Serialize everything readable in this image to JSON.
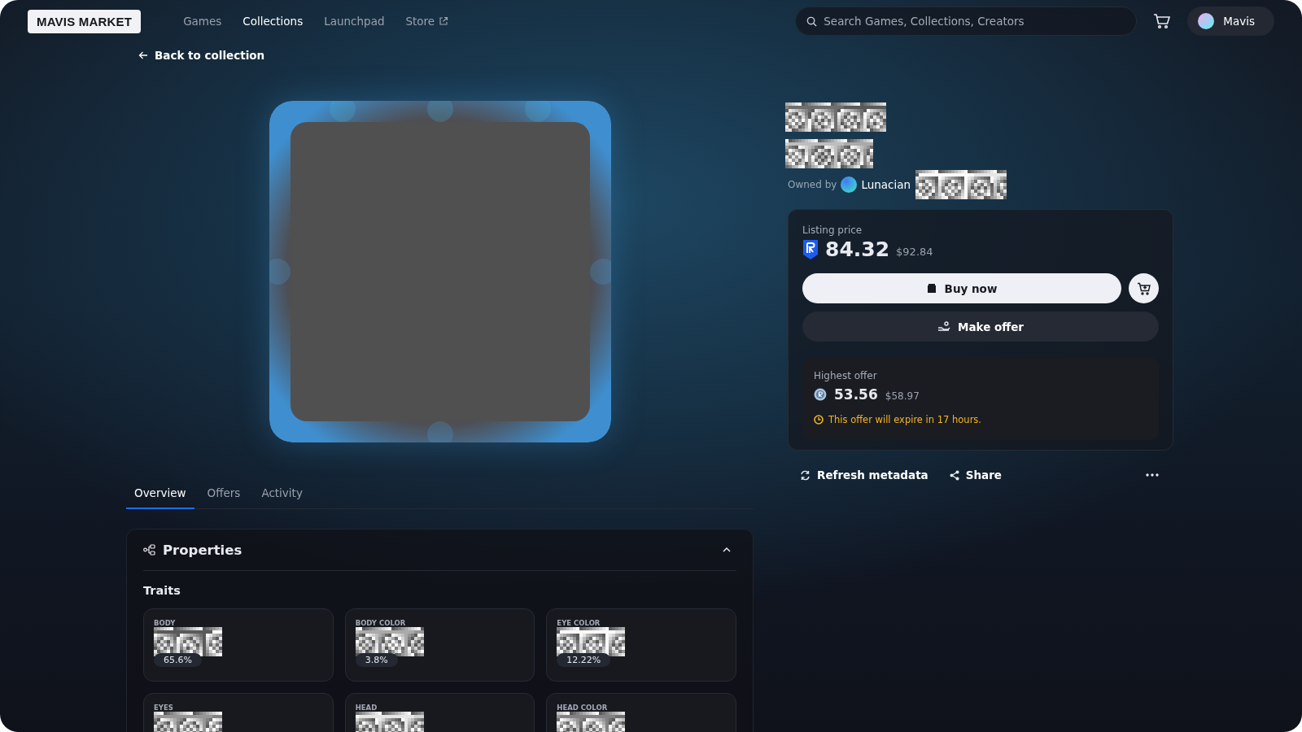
{
  "brand": "MAVIS MARKET",
  "nav": [
    {
      "label": "Games",
      "selected": false,
      "external": false
    },
    {
      "label": "Collections",
      "selected": true,
      "external": false
    },
    {
      "label": "Launchpad",
      "selected": false,
      "external": false
    },
    {
      "label": "Store",
      "selected": false,
      "external": true
    }
  ],
  "search": {
    "placeholder": "Search Games, Collections, Creators"
  },
  "account": {
    "name": "Mavis"
  },
  "back_link": "Back to collection",
  "owner": {
    "prefix": "Owned by",
    "name": "Lunacian"
  },
  "listing": {
    "label": "Listing price",
    "price": "84.32",
    "usd": "$92.84",
    "buy": "Buy now",
    "offer": "Make offer"
  },
  "highest_offer": {
    "label": "Highest offer",
    "price": "53.56",
    "usd": "$58.97",
    "note": "This offer will expire in 17 hours."
  },
  "actions": [
    {
      "label": "Refresh metadata",
      "kind": "refresh"
    },
    {
      "label": "Share",
      "kind": "share"
    }
  ],
  "tabs": [
    {
      "label": "Overview",
      "selected": true
    },
    {
      "label": "Offers",
      "selected": false
    },
    {
      "label": "Activity",
      "selected": false
    }
  ],
  "properties": {
    "title": "Properties",
    "expanded": true,
    "subtitle": "Traits",
    "traits": [
      {
        "name": "BODY",
        "share": "65.6%"
      },
      {
        "name": "BODY COLOR",
        "share": "3.8%"
      },
      {
        "name": "EYE COLOR",
        "share": "12.22%"
      },
      {
        "name": "EYES"
      },
      {
        "name": "HEAD"
      },
      {
        "name": "HEAD COLOR"
      }
    ]
  }
}
